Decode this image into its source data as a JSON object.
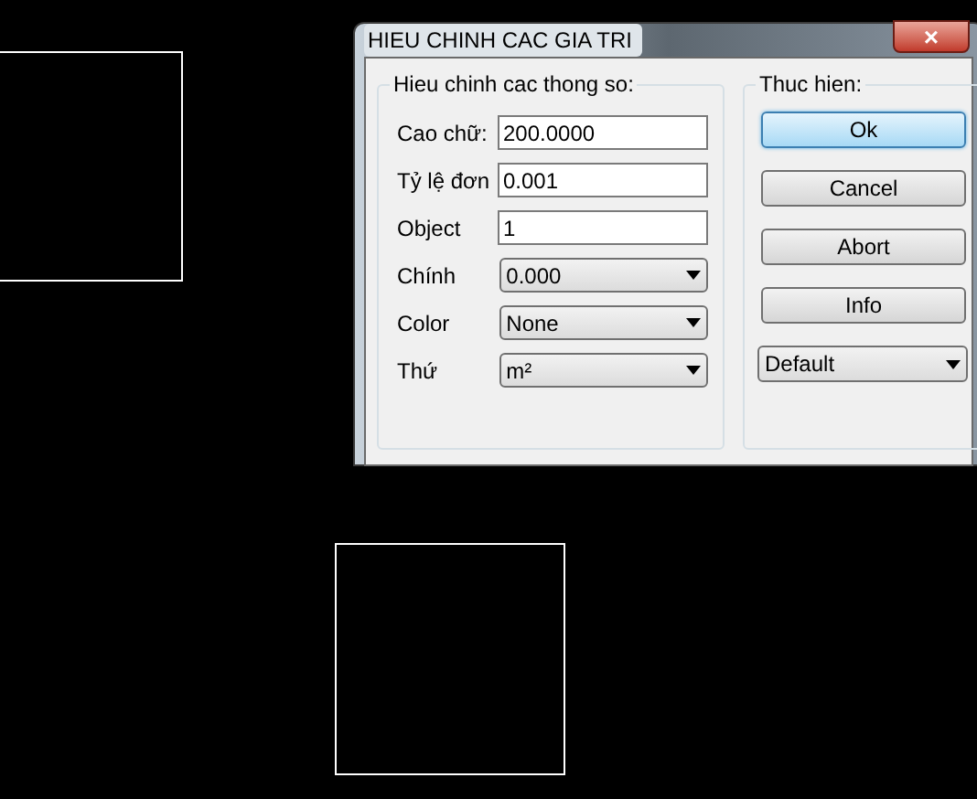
{
  "window": {
    "title": "HIEU CHINH CAC GIA TRI",
    "close": "×"
  },
  "params": {
    "title": "Hieu chinh cac thong so:",
    "fields": [
      {
        "label": "Cao chữ:",
        "kind": "text",
        "value": "200.0000"
      },
      {
        "label": "Tỷ lệ đơn",
        "kind": "text",
        "value": "0.001"
      },
      {
        "label": "Object",
        "kind": "text",
        "value": "1"
      },
      {
        "label": "Chính",
        "kind": "select",
        "value": "0.000"
      },
      {
        "label": "Color",
        "kind": "select",
        "value": "None"
      },
      {
        "label": "Thứ",
        "kind": "select",
        "value": "m²"
      }
    ]
  },
  "actions": {
    "title": "Thuc hien:",
    "buttons": [
      {
        "label": "Ok",
        "selected": true
      },
      {
        "label": "Cancel",
        "selected": false
      },
      {
        "label": "Abort",
        "selected": false
      },
      {
        "label": "Info",
        "selected": false
      }
    ],
    "select": {
      "value": "Default"
    }
  }
}
